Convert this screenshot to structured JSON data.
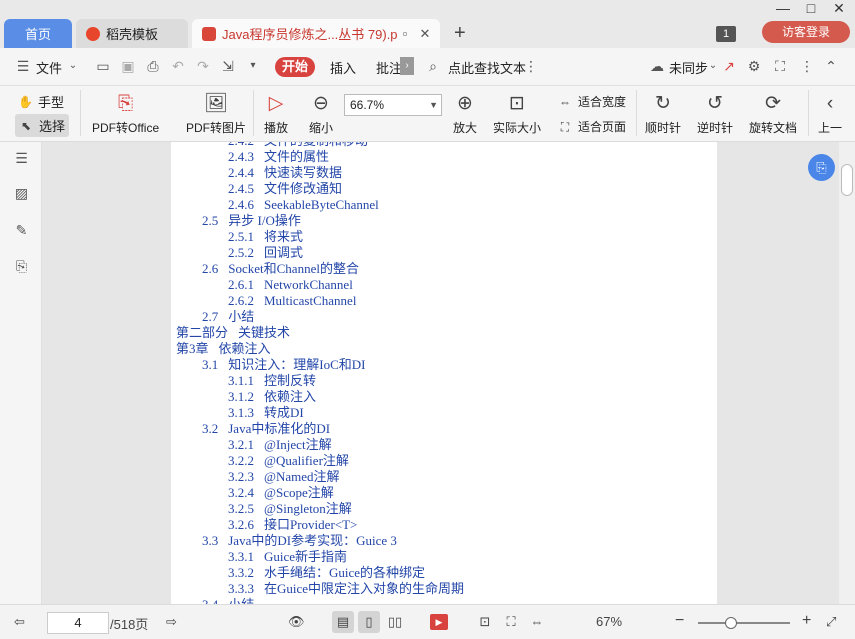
{
  "tabs": {
    "home": "首页",
    "template": "稻壳模板",
    "document": "Java程序员修炼之...丛书 79).pdf"
  },
  "titlebar": {
    "badge": "1",
    "login": "访客登录"
  },
  "menu": {
    "file": "文件",
    "start": "开始",
    "insert": "插入",
    "annotate": "批注",
    "search": "点此查找文本",
    "sync": "未同步"
  },
  "ribbon": {
    "hand": "手型",
    "select": "选择",
    "pdf_to_office": "PDF转Office",
    "pdf_to_image": "PDF转图片",
    "play": "播放",
    "zoom_out": "缩小",
    "zoom_value": "66.7%",
    "zoom_in": "放大",
    "actual_size": "实际大小",
    "fit_width": "适合宽度",
    "fit_page": "适合页面",
    "rotate_cw": "顺时针",
    "rotate_ccw": "逆时针",
    "rotate_doc": "旋转文档",
    "prev": "上一"
  },
  "toc": [
    {
      "level": 2,
      "num": "2.4.2",
      "text": "文件的复制和移动"
    },
    {
      "level": 2,
      "num": "2.4.3",
      "text": "文件的属性"
    },
    {
      "level": 2,
      "num": "2.4.4",
      "text": "快速读写数据"
    },
    {
      "level": 2,
      "num": "2.4.5",
      "text": "文件修改通知"
    },
    {
      "level": 2,
      "num": "2.4.6",
      "text": "SeekableByteChannel"
    },
    {
      "level": 1,
      "num": "2.5",
      "text": "异步 I/O操作"
    },
    {
      "level": 2,
      "num": "2.5.1",
      "text": "将来式"
    },
    {
      "level": 2,
      "num": "2.5.2",
      "text": "回调式"
    },
    {
      "level": 1,
      "num": "2.6",
      "text": "Socket和Channel的整合"
    },
    {
      "level": 2,
      "num": "2.6.1",
      "text": "NetworkChannel"
    },
    {
      "level": 2,
      "num": "2.6.2",
      "text": "MulticastChannel"
    },
    {
      "level": 1,
      "num": "2.7",
      "text": "小结"
    },
    {
      "level": 0,
      "num": "第二部分",
      "text": "关键技术"
    },
    {
      "level": 0,
      "num": "第3章",
      "text": "依赖注入"
    },
    {
      "level": 1,
      "num": "3.1",
      "text": "知识注入：理解IoC和DI"
    },
    {
      "level": 2,
      "num": "3.1.1",
      "text": "控制反转"
    },
    {
      "level": 2,
      "num": "3.1.2",
      "text": "依赖注入"
    },
    {
      "level": 2,
      "num": "3.1.3",
      "text": "转成DI"
    },
    {
      "level": 1,
      "num": "3.2",
      "text": "Java中标准化的DI"
    },
    {
      "level": 2,
      "num": "3.2.1",
      "text": "@Inject注解"
    },
    {
      "level": 2,
      "num": "3.2.2",
      "text": "@Qualifier注解"
    },
    {
      "level": 2,
      "num": "3.2.3",
      "text": "@Named注解"
    },
    {
      "level": 2,
      "num": "3.2.4",
      "text": "@Scope注解"
    },
    {
      "level": 2,
      "num": "3.2.5",
      "text": "@Singleton注解"
    },
    {
      "level": 2,
      "num": "3.2.6",
      "text": "接口Provider<T>"
    },
    {
      "level": 1,
      "num": "3.3",
      "text": "Java中的DI参考实现：Guice 3"
    },
    {
      "level": 2,
      "num": "3.3.1",
      "text": "Guice新手指南"
    },
    {
      "level": 2,
      "num": "3.3.2",
      "text": "水手绳结：Guice的各种绑定"
    },
    {
      "level": 2,
      "num": "3.3.3",
      "text": "在Guice中限定注入对象的生命周期"
    },
    {
      "level": 1,
      "num": "3.4",
      "text": "小结"
    }
  ],
  "status": {
    "page": "4",
    "total": "/518页",
    "zoom": "67%"
  },
  "colors": {
    "accent": "#d8433f",
    "home_tab": "#5a8ee6",
    "toc_link": "#2346a8"
  }
}
